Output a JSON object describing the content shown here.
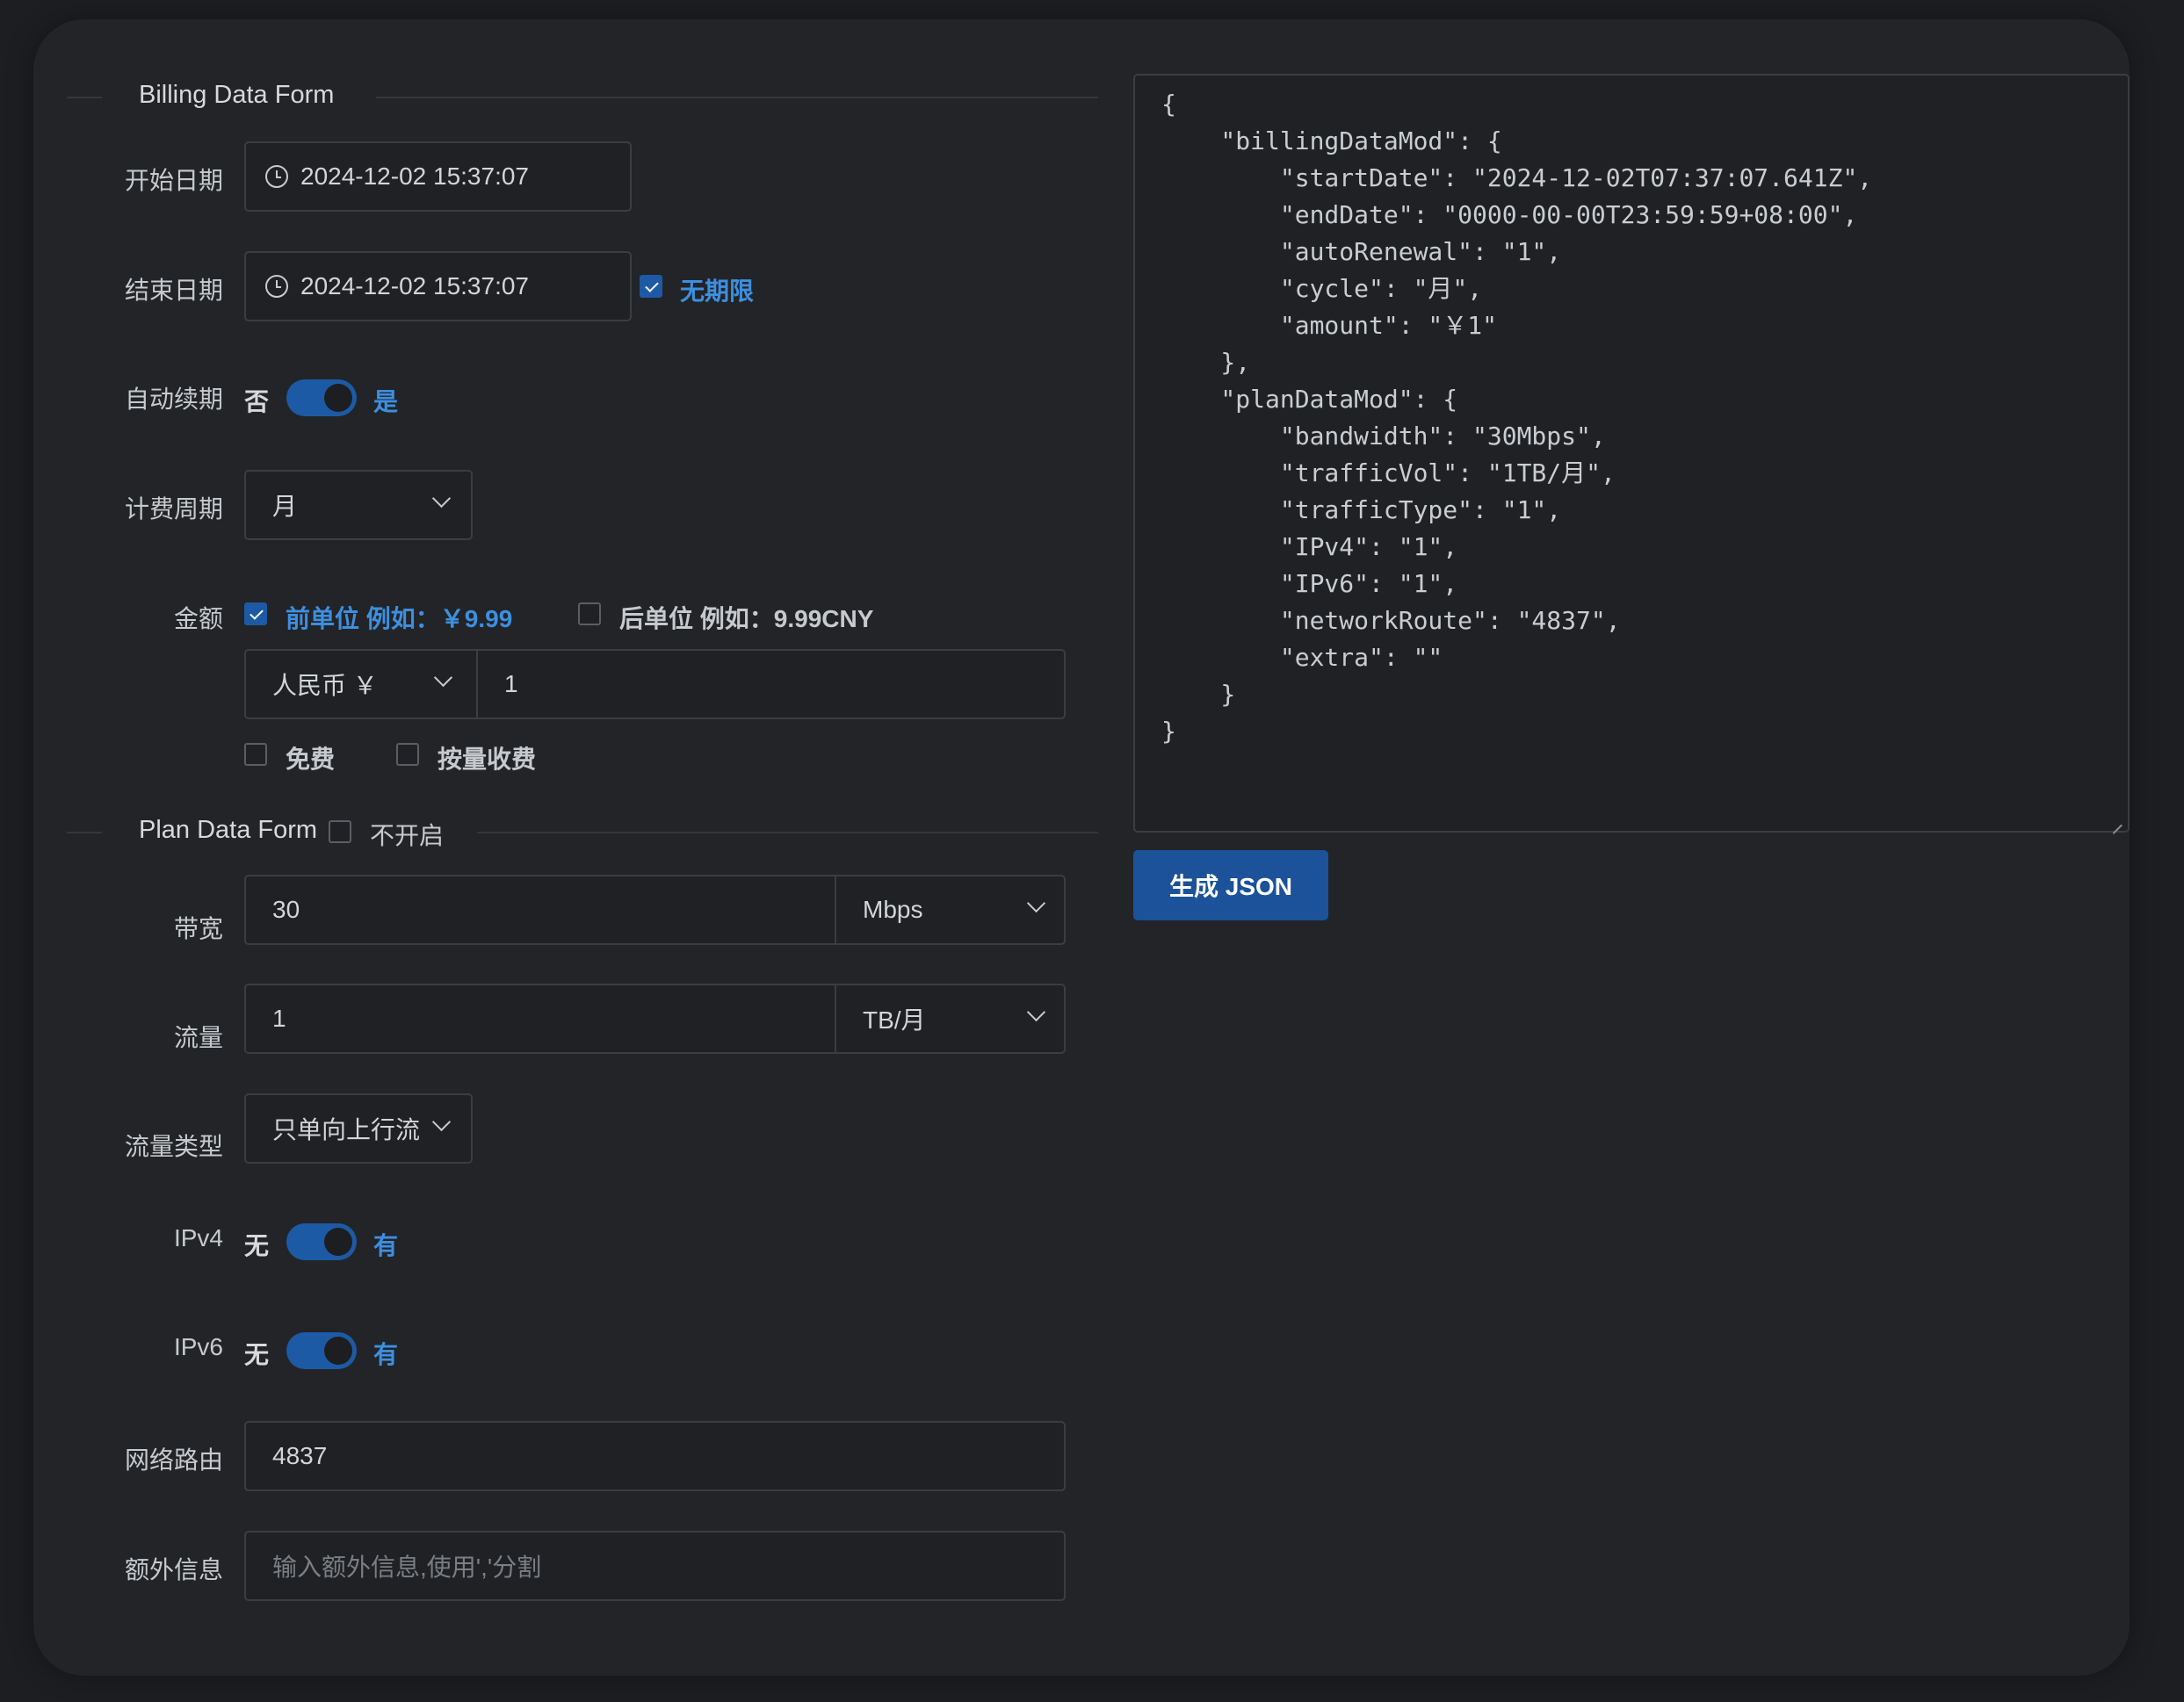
{
  "billing": {
    "section_title": "Billing Data Form",
    "start_date": {
      "label": "开始日期",
      "value": "2024-12-02 15:37:07"
    },
    "end_date": {
      "label": "结束日期",
      "value": "2024-12-02 15:37:07",
      "unlimited_label": "无期限",
      "unlimited_checked": true
    },
    "auto_renewal": {
      "label": "自动续期",
      "off_label": "否",
      "on_label": "是",
      "on": true
    },
    "cycle": {
      "label": "计费周期",
      "value": "月"
    },
    "amount": {
      "label": "金额",
      "prefix_label": "前单位 例如：￥9.99",
      "prefix_checked": true,
      "suffix_label": "后单位 例如：9.99CNY",
      "suffix_checked": false,
      "currency": "人民币 ￥",
      "value": "1",
      "free_label": "免费",
      "free_checked": false,
      "usage_label": "按量收费",
      "usage_checked": false
    }
  },
  "plan": {
    "section_title": "Plan Data Form",
    "disable_label": "不开启",
    "disable_checked": false,
    "bandwidth": {
      "label": "带宽",
      "value": "30",
      "unit": "Mbps"
    },
    "traffic": {
      "label": "流量",
      "value": "1",
      "unit": "TB/月"
    },
    "traffic_type": {
      "label": "流量类型",
      "value": "只单向上行流"
    },
    "ipv4": {
      "label": "IPv4",
      "off_label": "无",
      "on_label": "有",
      "on": true
    },
    "ipv6": {
      "label": "IPv6",
      "off_label": "无",
      "on_label": "有",
      "on": true
    },
    "network_route": {
      "label": "网络路由",
      "value": "4837"
    },
    "extra": {
      "label": "额外信息",
      "placeholder": "输入额外信息,使用','分割"
    }
  },
  "output": {
    "json_text": "{\n    \"billingDataMod\": {\n        \"startDate\": \"2024-12-02T07:37:07.641Z\",\n        \"endDate\": \"0000-00-00T23:59:59+08:00\",\n        \"autoRenewal\": \"1\",\n        \"cycle\": \"月\",\n        \"amount\": \"￥1\"\n    },\n    \"planDataMod\": {\n        \"bandwidth\": \"30Mbps\",\n        \"trafficVol\": \"1TB/月\",\n        \"trafficType\": \"1\",\n        \"IPv4\": \"1\",\n        \"IPv6\": \"1\",\n        \"networkRoute\": \"4837\",\n        \"extra\": \"\"\n    }\n}",
    "generate_button": "生成 JSON"
  },
  "colors": {
    "accent": "#3d8fe0",
    "toggle_on": "#1d5aa6",
    "button": "#1b5299",
    "background": "#222427"
  }
}
